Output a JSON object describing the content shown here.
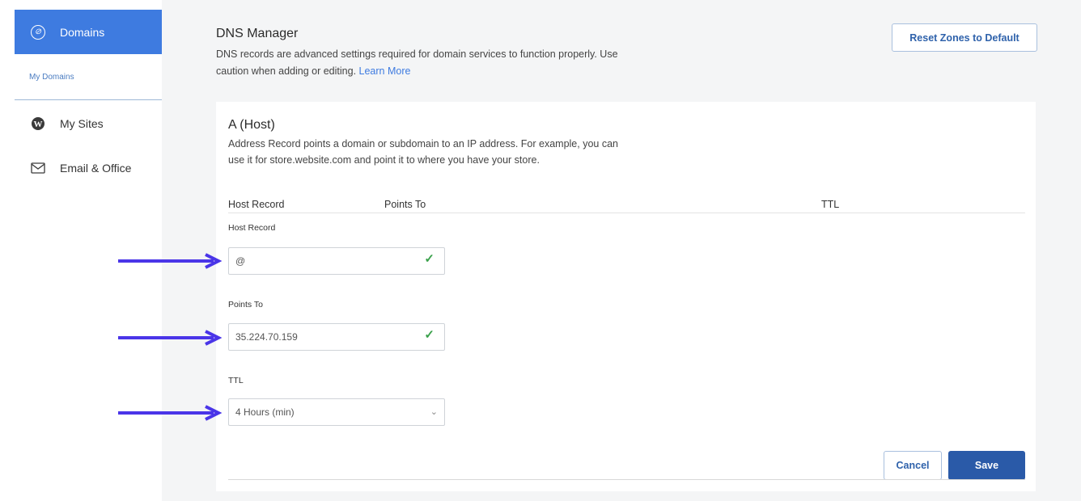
{
  "sidebar": {
    "domains_label": "Domains",
    "sub_label": "My Domains",
    "items": [
      {
        "label": "My Sites",
        "icon": "wordpress-icon"
      },
      {
        "label": "Email & Office",
        "icon": "envelope-icon"
      }
    ]
  },
  "header": {
    "title": "DNS Manager",
    "desc_text": "DNS records are advanced settings required for domain services to function properly. Use caution when adding or editing.",
    "learn_more": "Learn More",
    "reset_button": "Reset Zones to Default"
  },
  "record": {
    "title": "A (Host)",
    "desc": "Address Record points a domain or subdomain to an IP address. For example, you can use it for store.website.com and point it to where you have your store.",
    "columns": [
      "Host Record",
      "Points To",
      "TTL"
    ],
    "host_label": "Host Record",
    "host_value": "@",
    "points_label": "Points To",
    "points_value": "35.224.70.159",
    "ttl_label": "TTL",
    "ttl_value": "4 Hours (min)",
    "cancel_button": "Cancel",
    "save_button": "Save"
  },
  "colors": {
    "accent": "#3e7be0",
    "save": "#2a5aa8",
    "arrow": "#4a35e8",
    "check": "#3aa14b"
  }
}
